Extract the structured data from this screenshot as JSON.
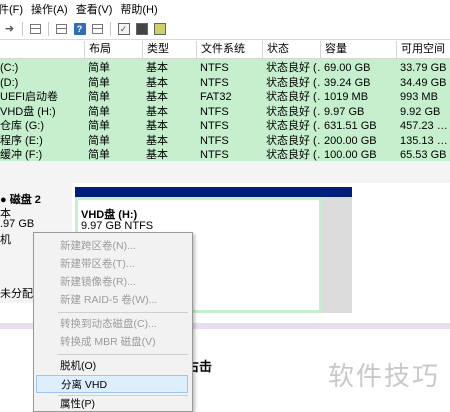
{
  "menu": [
    "件(F)",
    "操作(A)",
    "查看(V)",
    "帮助(H)"
  ],
  "table": {
    "columns": [
      "布局",
      "类型",
      "文件系统",
      "状态",
      "容量",
      "可用空间"
    ],
    "rows": [
      {
        "name": " (C:)",
        "layout": "简单",
        "type": "基本",
        "fs": "NTFS",
        "status": "状态良好 (…",
        "capacity": "69.00 GB",
        "free": "33.79 GB"
      },
      {
        "name": " (D:)",
        "layout": "简单",
        "type": "基本",
        "fs": "NTFS",
        "status": "状态良好 (…",
        "capacity": "39.24 GB",
        "free": "34.49 GB"
      },
      {
        "name": "UEFI启动卷",
        "layout": "简单",
        "type": "基本",
        "fs": "FAT32",
        "status": "状态良好 (…",
        "capacity": "1019 MB",
        "free": "993 MB"
      },
      {
        "name": "VHD盘 (H:)",
        "layout": "简单",
        "type": "基本",
        "fs": "NTFS",
        "status": "状态良好 (…",
        "capacity": "9.97 GB",
        "free": "9.92 GB"
      },
      {
        "name": "仓库 (G:)",
        "layout": "简单",
        "type": "基本",
        "fs": "NTFS",
        "status": "状态良好 (…",
        "capacity": "631.51 GB",
        "free": "457.23 …"
      },
      {
        "name": "程序 (E:)",
        "layout": "简单",
        "type": "基本",
        "fs": "NTFS",
        "status": "状态良好 (…",
        "capacity": "200.00 GB",
        "free": "135.13 …"
      },
      {
        "name": "缓冲 (F:)",
        "layout": "简单",
        "type": "基本",
        "fs": "NTFS",
        "status": "状态良好 (…",
        "capacity": "100.00 GB",
        "free": "65.53 GB"
      }
    ]
  },
  "disk": {
    "name": "磁盘 2",
    "type": "本",
    "size": ".97 GB",
    "state": "机",
    "unallocated": "未分配"
  },
  "partition": {
    "name": "VHD盘  (H:)",
    "detail": "9.97 GB NTFS"
  },
  "context_menu": [
    {
      "label": "新建跨区卷(N)...",
      "enabled": false
    },
    {
      "label": "新建带区卷(T)...",
      "enabled": false
    },
    {
      "label": "新建镜像卷(R)...",
      "enabled": false
    },
    {
      "label": "新建 RAID-5 卷(W)...",
      "enabled": false
    },
    {
      "label": "转换到动态磁盘(C)...",
      "enabled": false
    },
    {
      "label": "转换成 MBR 磁盘(V)",
      "enabled": false
    },
    {
      "label": "脱机(O)",
      "enabled": true
    },
    {
      "label": "分离 VHD",
      "enabled": true,
      "highlighted": true
    },
    {
      "label": "属性(P)",
      "enabled": true
    }
  ],
  "document": {
    "text_right": "右击"
  },
  "watermark": "软件技巧"
}
